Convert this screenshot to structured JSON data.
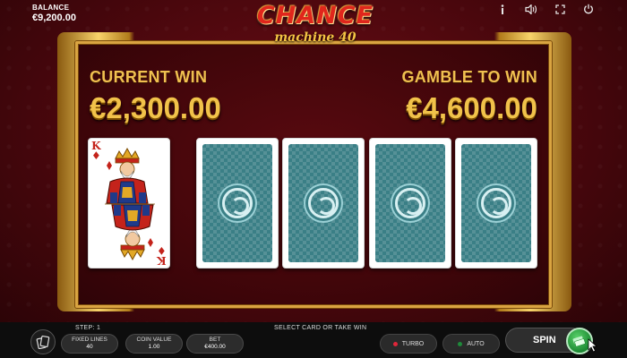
{
  "header": {
    "balance_label": "BALANCE",
    "balance_value": "€9,200.00",
    "icons": [
      "info-icon",
      "sound-icon",
      "fullscreen-icon",
      "power-icon"
    ]
  },
  "logo": {
    "title": "CHANCE",
    "subtitle": "machine 40"
  },
  "gamble": {
    "current_win_label": "CURRENT WIN",
    "current_win_value": "€2,300.00",
    "gamble_label": "GAMBLE TO WIN",
    "gamble_value": "€4,600.00",
    "dealer_card": {
      "rank": "K",
      "suit": "♦"
    },
    "face_down_cards": 4
  },
  "bottom": {
    "step": "STEP: 1",
    "hint": "SELECT CARD OR TAKE WIN",
    "fixed_lines_label": "FIXED LINES",
    "fixed_lines_value": "40",
    "coin_value_label": "COIN VALUE",
    "coin_value_value": "1.00",
    "bet_label": "BET",
    "bet_value": "€400.00",
    "turbo_label": "TURBO",
    "auto_label": "AUTO",
    "spin_label": "SPIN"
  },
  "colors": {
    "gold": "#f1c24a",
    "background": "#4a070d",
    "card_back": "#3a7f86",
    "turbo_dot": "#e0263a",
    "auto_dot": "#1e8a3a",
    "collect_chip": "#1c8a33"
  }
}
